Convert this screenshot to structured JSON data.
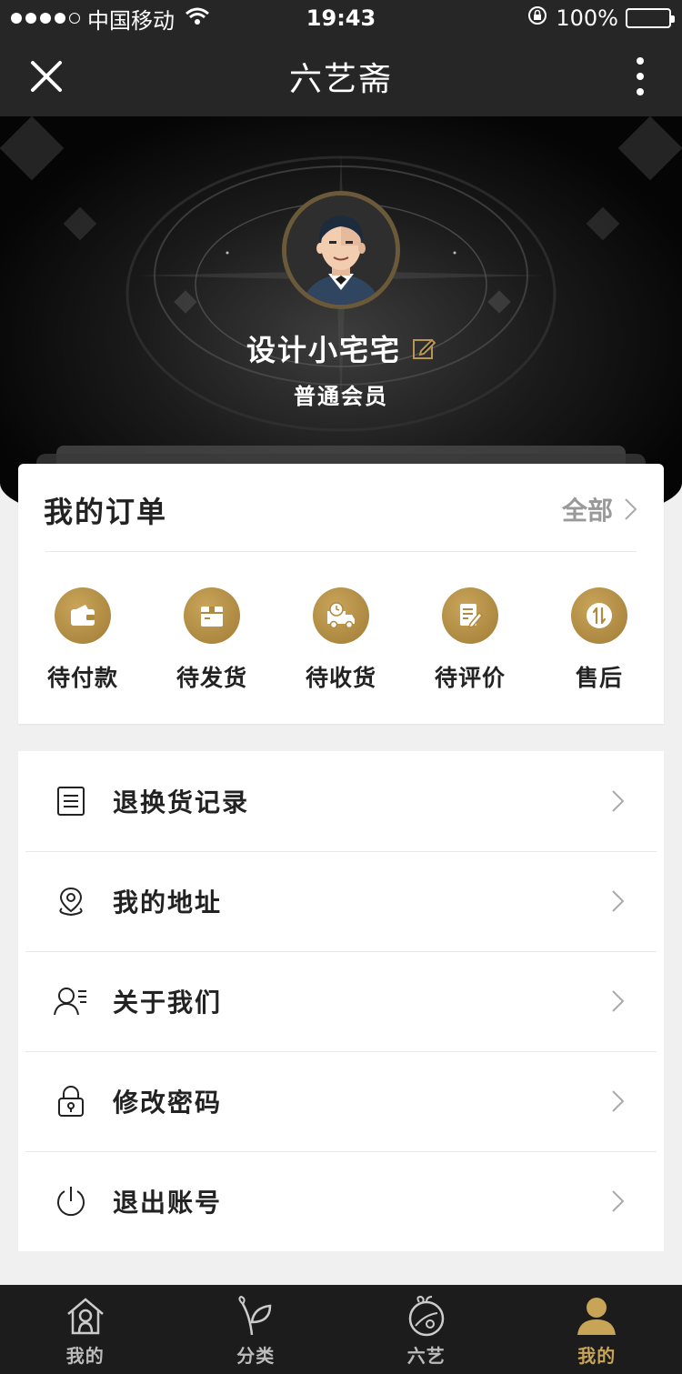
{
  "status_bar": {
    "carrier": "中国移动",
    "time": "19:43",
    "battery": "100%"
  },
  "nav": {
    "title": "六艺斋"
  },
  "profile": {
    "username": "设计小宅宅",
    "member_level": "普通会员"
  },
  "orders": {
    "title": "我的订单",
    "all_label": "全部",
    "items": [
      {
        "label": "待付款",
        "icon": "wallet-icon"
      },
      {
        "label": "待发货",
        "icon": "box-icon"
      },
      {
        "label": "待收货",
        "icon": "delivery-truck-icon"
      },
      {
        "label": "待评价",
        "icon": "review-edit-icon"
      },
      {
        "label": "售后",
        "icon": "after-sales-icon"
      }
    ]
  },
  "menu": {
    "items": [
      {
        "label": "退换货记录",
        "icon": "list-document-icon"
      },
      {
        "label": "我的地址",
        "icon": "location-pin-icon"
      },
      {
        "label": "关于我们",
        "icon": "user-info-icon"
      },
      {
        "label": "修改密码",
        "icon": "lock-icon"
      },
      {
        "label": "退出账号",
        "icon": "power-icon"
      }
    ]
  },
  "tabs": [
    {
      "label": "我的",
      "icon": "home-icon",
      "active": false
    },
    {
      "label": "分类",
      "icon": "leaf-icon",
      "active": false
    },
    {
      "label": "六艺",
      "icon": "peach-icon",
      "active": false
    },
    {
      "label": "我的",
      "icon": "person-icon",
      "active": true
    }
  ],
  "colors": {
    "gold_accent": "#c8a457",
    "dark_bar": "#262626",
    "page_background": "#f0f0f0"
  }
}
